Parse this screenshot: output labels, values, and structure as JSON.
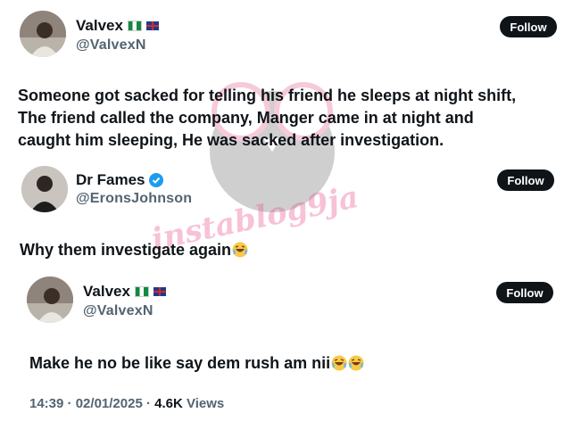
{
  "watermark": {
    "text": "instablog9ja"
  },
  "posts": [
    {
      "author": "Valvex",
      "handle": "@ValvexN",
      "follow_label": "Follow",
      "flags": [
        "nigeria-flag",
        "uk-flag"
      ],
      "text_lines": [
        "Someone got sacked for telling his friend he sleeps at night shift,",
        "The friend called the company, Manger came in at night and",
        "caught him sleeping, He was sacked after investigation."
      ]
    },
    {
      "author": "Dr Fames",
      "handle": "@EronsJohnson",
      "follow_label": "Follow",
      "verified": true,
      "text": "Why them investigate again"
    },
    {
      "author": "Valvex",
      "handle": "@ValvexN",
      "follow_label": "Follow",
      "flags": [
        "nigeria-flag",
        "uk-flag"
      ],
      "text": "Make he no be like say dem rush am nii",
      "meta": {
        "time": "14:39",
        "date": "02/01/2025",
        "views": "4.6K",
        "views_label": "Views"
      }
    }
  ],
  "colors": {
    "follow_bg": "#0f1419",
    "secondary_text": "#536471",
    "verified": "#1d9bf0"
  }
}
